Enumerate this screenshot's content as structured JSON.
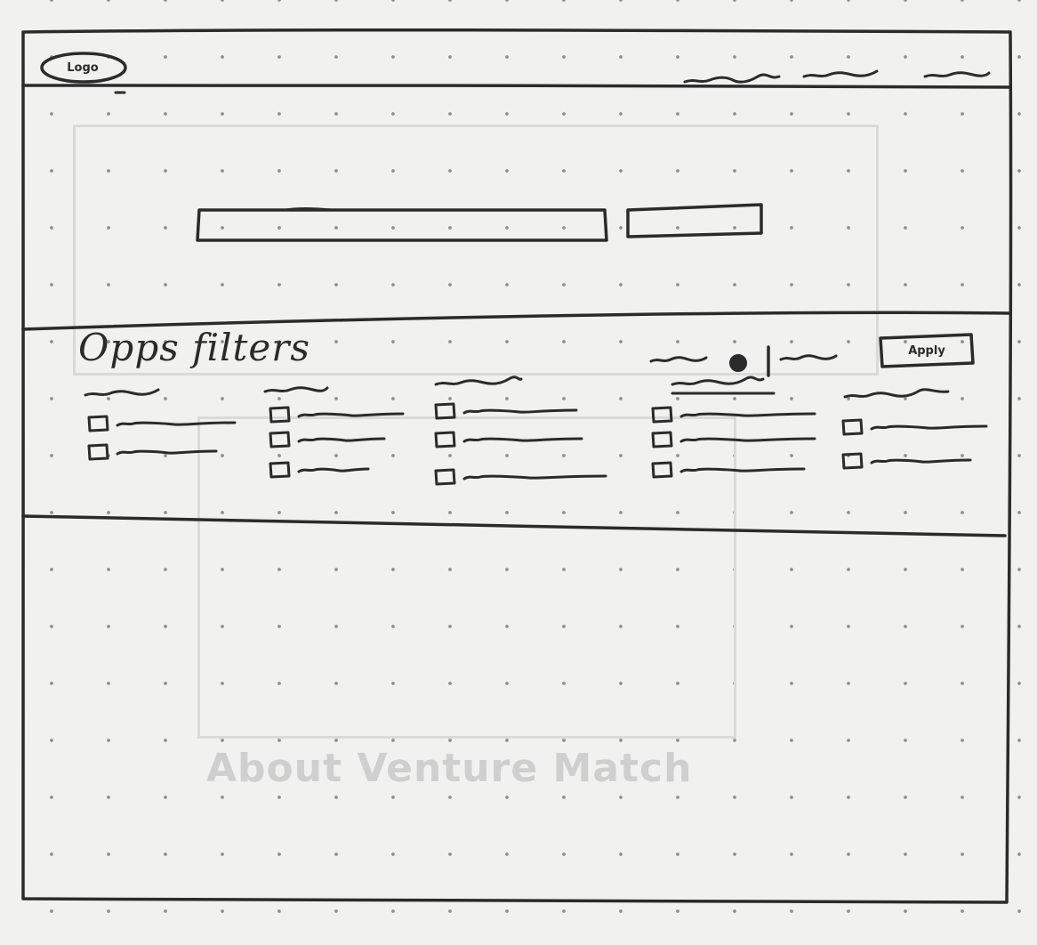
{
  "header": {
    "logo_text": "Logo",
    "nav_items": [
      "",
      "",
      ""
    ]
  },
  "hero": {
    "search_placeholder": "",
    "search_button_label": ""
  },
  "filters": {
    "title": "Opps filters",
    "toggle_label_left": "",
    "toggle_label_right": "",
    "apply_label": "Apply",
    "columns": [
      {
        "heading": "",
        "options": [
          "",
          ""
        ]
      },
      {
        "heading": "",
        "options": [
          "",
          "",
          ""
        ]
      },
      {
        "heading": "",
        "options": [
          "",
          "",
          ""
        ]
      },
      {
        "heading": "",
        "options": [
          "",
          "",
          ""
        ]
      },
      {
        "heading": "",
        "options": [
          "",
          ""
        ]
      }
    ]
  },
  "background_bleed": {
    "title": "About Venture Match"
  },
  "colors": {
    "ink": "#2b2b2b",
    "paper": "#f1f1f0",
    "dot": "#8f8f8f",
    "bleed": "#cfcfcf"
  }
}
